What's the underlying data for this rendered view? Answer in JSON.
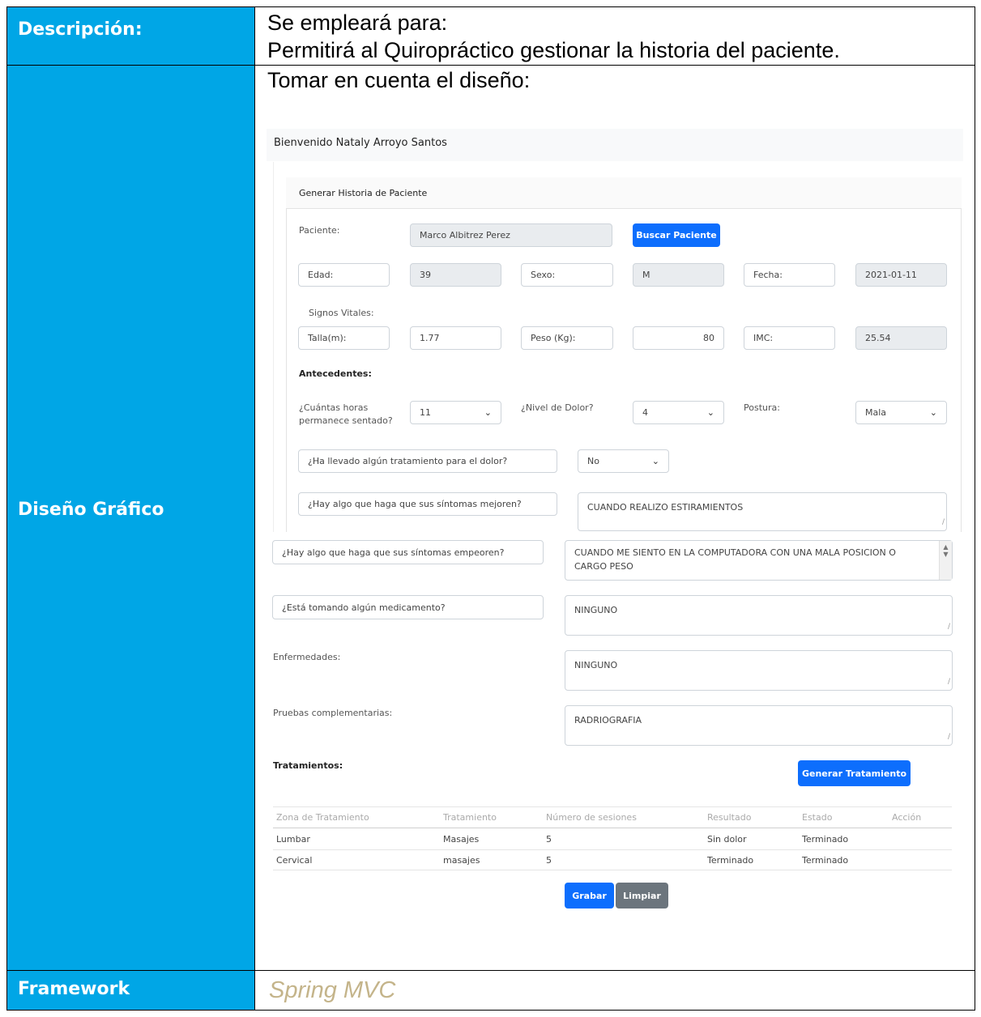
{
  "rows": {
    "descripcion": {
      "label": "Descripción:",
      "line1": "Se empleará para:",
      "line2": "Permitirá al Quiropráctico gestionar la historia del paciente."
    },
    "diseno": {
      "label": "Diseño Gráfico",
      "intro": "Tomar en cuenta el diseño:"
    },
    "framework": {
      "label": "Framework",
      "value": "Spring MVC"
    }
  },
  "design": {
    "welcome": "Bienvenido Nataly Arroyo Santos",
    "card_title": "Generar Historia de Paciente",
    "paciente_label": "Paciente:",
    "paciente_value": "Marco  Albitrez Perez",
    "buscar_button": "Buscar Paciente",
    "edad_label": "Edad:",
    "edad_value": "39",
    "sexo_label": "Sexo:",
    "sexo_value": "M",
    "fecha_label": "Fecha:",
    "fecha_value": "2021-01-11",
    "signos_label": "Signos Vitales:",
    "talla_label": "Talla(m):",
    "talla_value": "1.77",
    "peso_label": "Peso (Kg):",
    "peso_value": "80",
    "imc_label": "IMC:",
    "imc_value": "25.54",
    "antecedentes_label": "Antecedentes:",
    "horas_label_1": "¿Cuántas horas",
    "horas_label_2": "permanece sentado?",
    "horas_value": "11",
    "dolor_label": "¿Nivel de Dolor?",
    "dolor_value": "4",
    "postura_label": "Postura:",
    "postura_value": "Mala",
    "tratamiento_q": "¿Ha llevado algún tratamiento para el dolor?",
    "tratamiento_value": "No",
    "mejoren_q": "¿Hay algo que haga que sus síntomas mejoren?",
    "mejoren_value": "CUANDO REALIZO ESTIRAMIENTOS",
    "empeoren_q": "¿Hay algo que haga que sus síntomas empeoren?",
    "empeoren_value_1": "CUANDO ME SIENTO EN LA COMPUTADORA CON UNA MALA POSICION O",
    "empeoren_value_2": "CARGO PESO",
    "medicamento_q": "¿Está tomando algún medicamento?",
    "medicamento_value": "NINGUNO",
    "enfermedades_label": "Enfermedades:",
    "enfermedades_value": "NINGUNO",
    "pruebas_label": "Pruebas complementarias:",
    "pruebas_value": "RADRIOGRAFIA",
    "tratamientos_label": "Tratamientos:",
    "generar_button": "Generar Tratamiento",
    "table_headers": [
      "Zona de Tratamiento",
      "Tratamiento",
      "Número de sesiones",
      "Resultado",
      "Estado",
      "Acción"
    ],
    "table_rows": [
      [
        "Lumbar",
        "Masajes",
        "5",
        "Sin dolor",
        "Terminado",
        ""
      ],
      [
        "Cervical",
        "masajes",
        "5",
        "Terminado",
        "Terminado",
        ""
      ]
    ],
    "grabar_button": "Grabar",
    "limpiar_button": "Limpiar"
  },
  "colors": {
    "label_bg": "#00a6e6",
    "primary_button": "#0d6efd",
    "secondary_button": "#6c757d",
    "framework_text": "#c4b48a"
  }
}
